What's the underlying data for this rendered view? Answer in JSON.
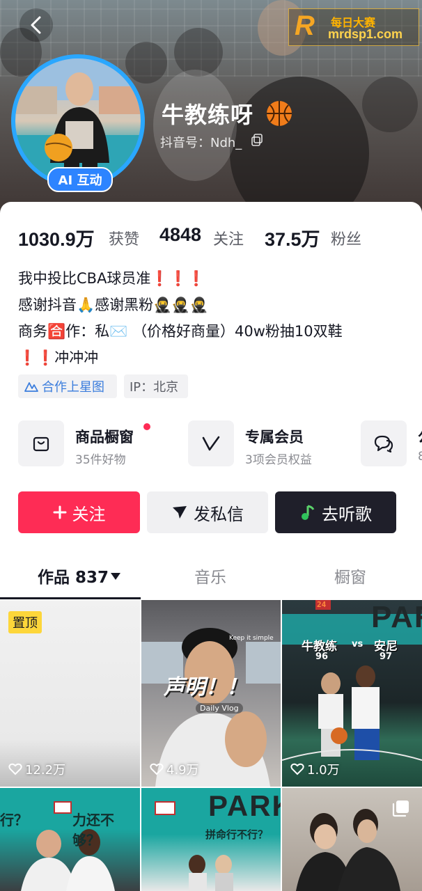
{
  "header": {
    "nickname": "牛教练呀",
    "handle": "抖音号：Ndh_",
    "ai_badge": "AI 互动",
    "watermark_line1": "每日大赛",
    "watermark_line2": "mrdsp1.com",
    "watermark_logo": "R"
  },
  "stats": [
    {
      "value": "1030.9万",
      "label": "获赞"
    },
    {
      "value": "4848",
      "label": "关注"
    },
    {
      "value": "37.5万",
      "label": "粉丝"
    }
  ],
  "bio": [
    "我中投比CBA球员准❗❗❗",
    "感谢抖音🙏感谢黑粉🥷🥷🥷",
    "商务🈴作：私✉️ （价格好商量）40w粉抽10双鞋",
    "❗❗冲冲冲"
  ],
  "tags": {
    "star_map": "合作上星图",
    "ip": "IP：北京"
  },
  "tools": [
    {
      "title": "商品橱窗",
      "sub": "35件好物",
      "icon": "shopping-bag-icon"
    },
    {
      "title": "专属会员",
      "sub": "3项会员权益",
      "icon": "v-member-icon"
    },
    {
      "title": "公",
      "sub": "8",
      "icon": "chat-group-icon"
    }
  ],
  "actions": {
    "follow": "关注",
    "message": "发私信",
    "music": "去听歌"
  },
  "tabs": {
    "works": "作品 837",
    "music": "音乐",
    "shop": "橱窗"
  },
  "videos": [
    {
      "likes": "12.2万",
      "pinned": "置顶"
    },
    {
      "likes": "4.9万",
      "caption": "声明！！",
      "small1": "Keep it simple",
      "small2": "Daily Vlog"
    },
    {
      "likes": "1.0万",
      "left_name": "牛教练",
      "vs": "vs",
      "right_name": "安尼",
      "left_score": "96",
      "right_score": "97",
      "scoreboard": "24",
      "park": "PAR"
    },
    {
      "text": "行？",
      "text2": "力还不够？",
      "scoreboard": "24"
    },
    {
      "text": "行不行？",
      "text2": "拼命行不行？",
      "park": "PARK"
    },
    {}
  ],
  "colors": {
    "follow_red": "#fe2c55",
    "dark_button": "#1f1f2a",
    "badge_blue": "#2d84ff",
    "pinned_yellow": "#fdd63a"
  }
}
